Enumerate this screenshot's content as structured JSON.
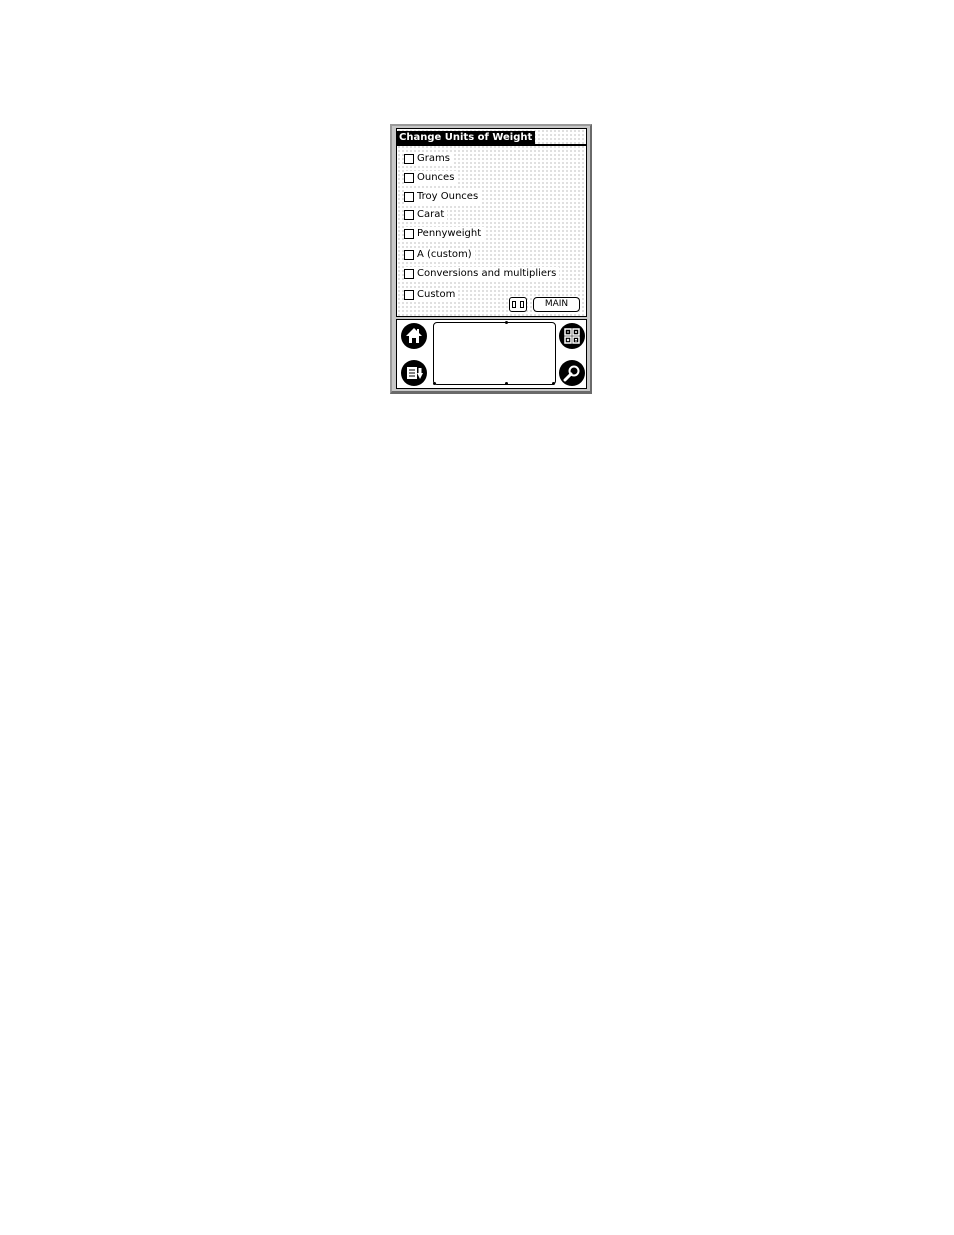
{
  "form": {
    "title": "Change Units of Weight",
    "options": [
      {
        "label": "Grams",
        "checked": false
      },
      {
        "label": "Ounces",
        "checked": false
      },
      {
        "label": "Troy Ounces",
        "checked": false
      },
      {
        "label": "Carat",
        "checked": false
      },
      {
        "label": "Pennyweight",
        "checked": false
      },
      {
        "label": "A (custom)",
        "checked": false
      },
      {
        "label": "Conversions and multipliers",
        "checked": false
      },
      {
        "label": "Custom",
        "checked": false
      }
    ],
    "main_button_label": "MAIN"
  },
  "silkscreen": {
    "icons": [
      "home-icon",
      "calculator-icon",
      "menu-icon",
      "find-icon"
    ]
  }
}
